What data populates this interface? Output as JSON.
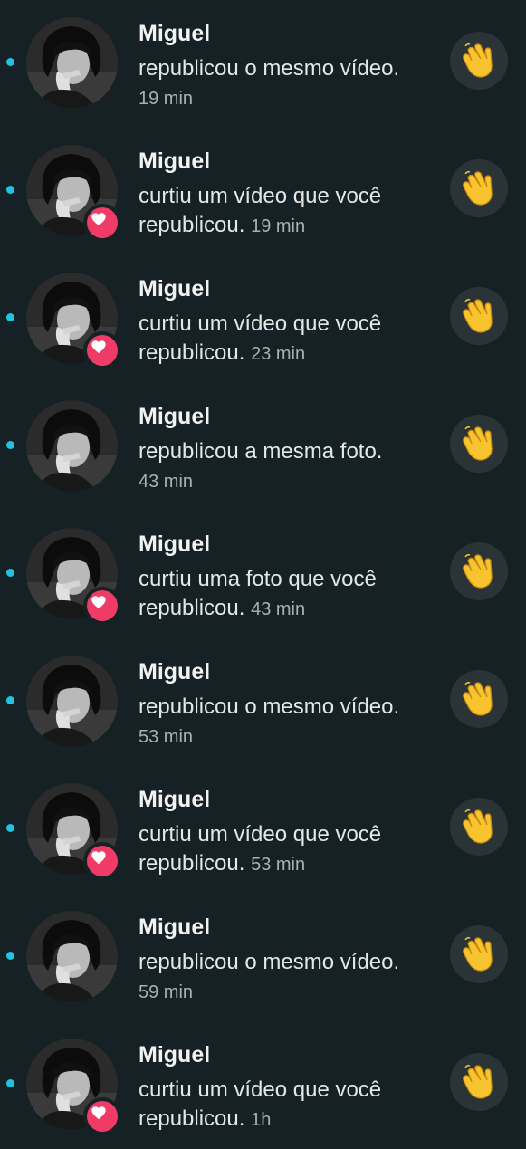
{
  "colors": {
    "background": "#152124",
    "unread_dot": "#20c3e0",
    "heart_badge": "#f03b67",
    "wave_button": "#2a3437"
  },
  "icons": {
    "unread": "unread-dot",
    "like": "heart-icon",
    "wave": "waving-hand-icon"
  },
  "notifications": [
    {
      "name": "Miguel",
      "line1": "republicou o mesmo vídeo.",
      "line2": "",
      "time": "19 min",
      "liked": false
    },
    {
      "name": "Miguel",
      "line1": "curtiu um vídeo que você",
      "line2": "republicou.",
      "time": "19 min",
      "liked": true
    },
    {
      "name": "Miguel",
      "line1": "curtiu um vídeo que você",
      "line2": "republicou.",
      "time": "23 min",
      "liked": true
    },
    {
      "name": "Miguel",
      "line1": "republicou a mesma foto.",
      "line2": "",
      "time": "43 min",
      "liked": false
    },
    {
      "name": "Miguel",
      "line1": "curtiu uma foto que você",
      "line2": "republicou.",
      "time": "43 min",
      "liked": true
    },
    {
      "name": "Miguel",
      "line1": "republicou o mesmo vídeo.",
      "line2": "",
      "time": "53 min",
      "liked": false
    },
    {
      "name": "Miguel",
      "line1": "curtiu um vídeo que você",
      "line2": "republicou.",
      "time": "53 min",
      "liked": true
    },
    {
      "name": "Miguel",
      "line1": "republicou o mesmo vídeo.",
      "line2": "",
      "time": "59 min",
      "liked": false
    },
    {
      "name": "Miguel",
      "line1": "curtiu um vídeo que você",
      "line2": "republicou.",
      "time": "1h",
      "liked": true
    }
  ]
}
